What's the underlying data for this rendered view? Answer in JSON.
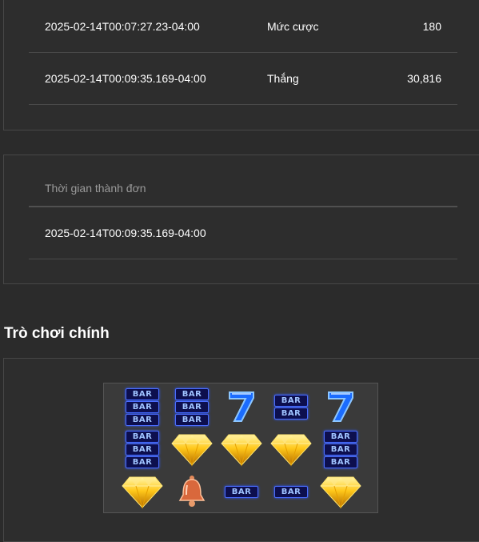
{
  "transactions": [
    {
      "time": "2025-02-14T00:07:27.23-04:00",
      "label": "Mức cược",
      "value": "180"
    },
    {
      "time": "2025-02-14T00:09:35.169-04:00",
      "label": "Thắng",
      "value": "30,816"
    }
  ],
  "completion": {
    "header": "Thời gian thành đơn",
    "time": "2025-02-14T00:09:35.169-04:00"
  },
  "main_game": {
    "title": "Trò chơi chính",
    "bar_text": "BAR",
    "grid": [
      [
        "triple-bar",
        "triple-bar",
        "seven",
        "double-bar",
        "seven"
      ],
      [
        "triple-bar",
        "diamond",
        "diamond",
        "diamond",
        "triple-bar"
      ],
      [
        "diamond",
        "bell",
        "single-bar",
        "single-bar",
        "diamond"
      ]
    ]
  }
}
